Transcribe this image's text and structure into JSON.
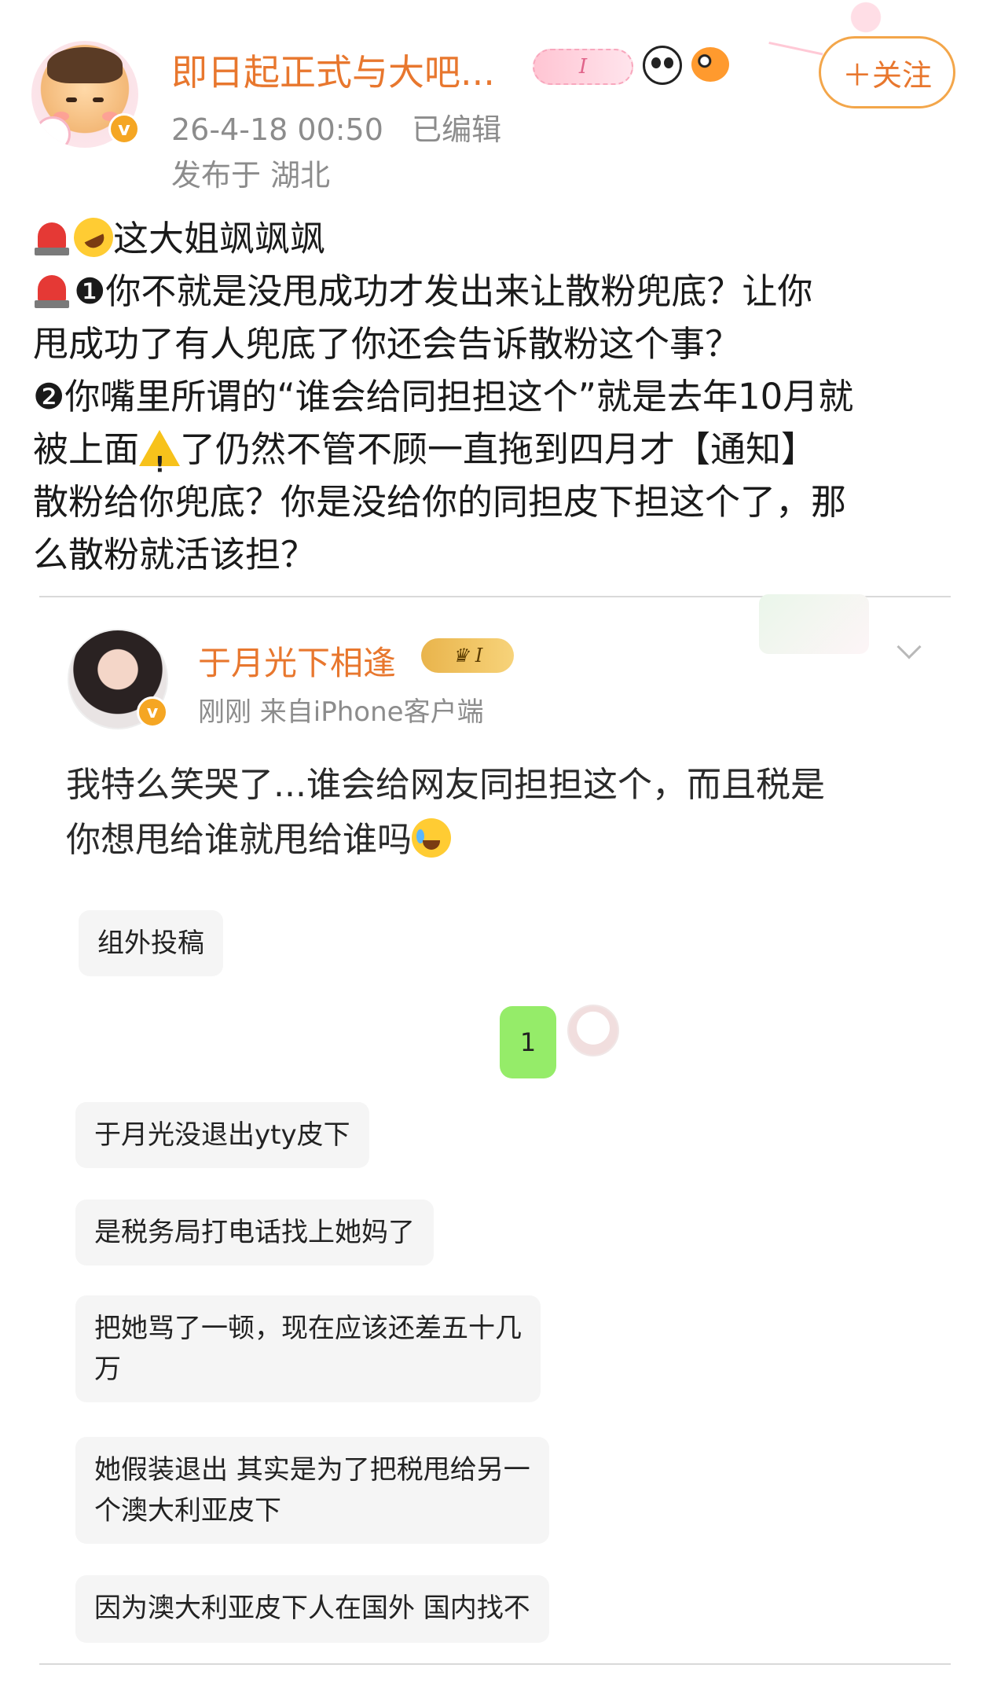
{
  "header": {
    "username": "即日起正式与大吧...",
    "level_badge": "I",
    "timestamp": "26-4-18 00:50",
    "edited_label": "已编辑",
    "location": "发布于 湖北",
    "follow_label": "＋关注",
    "verify_mark": "v",
    "colors": {
      "username": "#e8772e",
      "meta": "#8c8c8c",
      "follow_border": "#f3a64a"
    }
  },
  "post": {
    "line1": "这大姐飒飒飒",
    "line2": "❶你不就是没甩成功才发出来让散粉兜底？让你",
    "line3": "甩成功了有人兜底了你还会告诉散粉这个事？",
    "line4": "❷你嘴里所谓的“谁会给同担担这个”就是去年10月就",
    "line5a": "被上面",
    "line5b": "了仍然不管不顾一直拖到四月才【通知】",
    "line6": "散粉给你兜底？你是没给你的同担皮下担这个了，那",
    "line7": "么散粉就活该担？"
  },
  "embedded": {
    "username": "于月光下相逢",
    "crown_badge": "I",
    "meta": "刚刚  来自iPhone客户端",
    "text_line1": "我特么笑哭了...谁会给网友同担担这个，而且税是",
    "text_line2": "你想甩给谁就甩给谁吗",
    "chat": {
      "group_label": "组外投稿",
      "reply_number": "1",
      "messages": [
        [
          "于月光没退出yty皮下"
        ],
        [
          "是税务局打电话找上她妈了"
        ],
        [
          "把她骂了一顿，现在应该还差五十几",
          "万"
        ],
        [
          "她假装退出 其实是为了把税甩给另一",
          "个澳大利亚皮下"
        ],
        [
          "因为澳大利亚皮下人在国外 国内找不"
        ]
      ]
    }
  },
  "icons": [
    "siren-icon",
    "laugh-icon",
    "warning-icon",
    "panda-icon",
    "fish-icon",
    "chevron-down-icon",
    "cry-laugh-icon"
  ]
}
